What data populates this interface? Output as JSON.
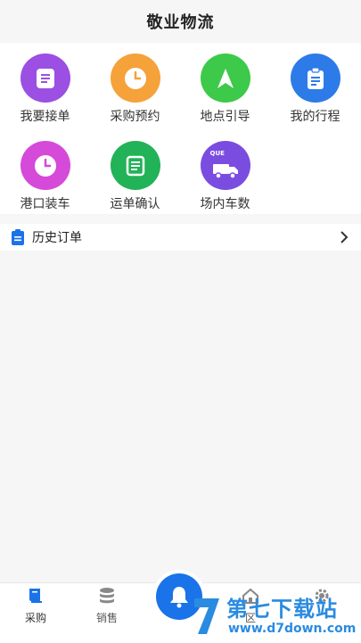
{
  "header": {
    "title": "敬业物流"
  },
  "grid": {
    "items": [
      {
        "label": "我要接单",
        "icon": "order-list-icon",
        "color": "#9b4fe3"
      },
      {
        "label": "采购预约",
        "icon": "clock-icon",
        "color": "#f5a23a"
      },
      {
        "label": "地点引导",
        "icon": "navigation-arrow-icon",
        "color": "#3dc94a"
      },
      {
        "label": "我的行程",
        "icon": "clipboard-icon",
        "color": "#2d7be8"
      },
      {
        "label": "港口装车",
        "icon": "clock-icon",
        "color": "#d54ad9"
      },
      {
        "label": "运单确认",
        "icon": "document-icon",
        "color": "#22b257"
      },
      {
        "label": "场内车数",
        "icon": "truck-icon",
        "color": "#7b4ce0"
      }
    ],
    "truck_badge": "QUE"
  },
  "history": {
    "label": "历史订单"
  },
  "tabbar": {
    "tabs": [
      {
        "label": "采购",
        "icon": "book-icon"
      },
      {
        "label": "销售",
        "icon": "database-icon"
      },
      {
        "label": "区",
        "icon": "home-icon"
      },
      {
        "label": "",
        "icon": "gear-icon"
      }
    ],
    "center_icon": "bell-icon",
    "accent": "#1a73e8"
  },
  "watermark": {
    "title": "第七下载站",
    "url": "www.d7down.com"
  }
}
